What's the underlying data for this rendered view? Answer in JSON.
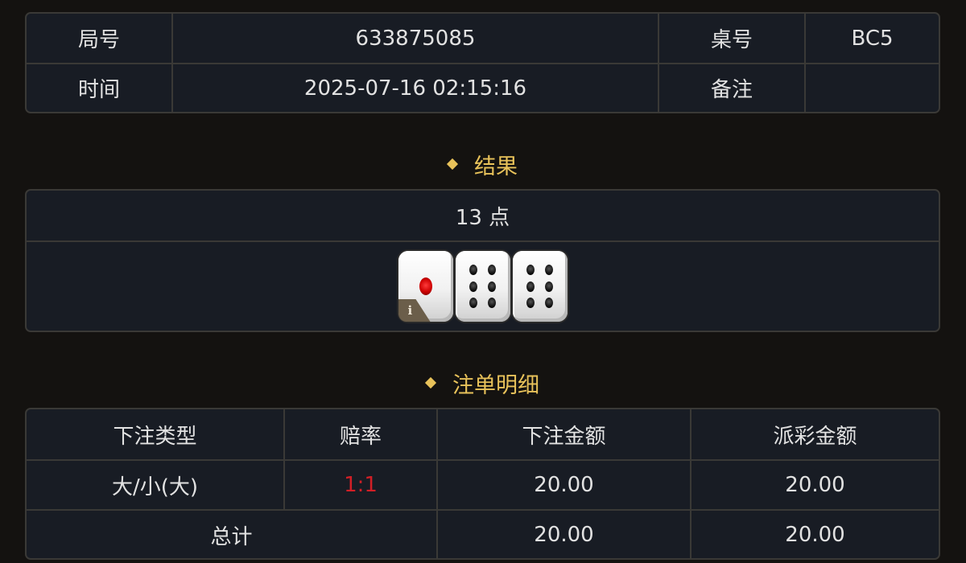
{
  "info": {
    "round_label": "局号",
    "round_value": "633875085",
    "table_label": "桌号",
    "table_value": "BC5",
    "time_label": "时间",
    "time_value": "2025-07-16 02:15:16",
    "remark_label": "备注",
    "remark_value": ""
  },
  "result": {
    "title": "结果",
    "points_text": "13 点",
    "dice": [
      1,
      6,
      6
    ],
    "info_badge": "i"
  },
  "bets": {
    "title": "注单明细",
    "headers": [
      "下注类型",
      "赔率",
      "下注金额",
      "派彩金额"
    ],
    "rows": [
      {
        "type": "大/小(大)",
        "odds": "1:1",
        "stake": "20.00",
        "payout": "20.00"
      }
    ],
    "total": {
      "label": "总计",
      "stake": "20.00",
      "payout": "20.00"
    }
  },
  "colors": {
    "accent": "#e8c25a",
    "odds": "#d21f26",
    "panel_bg": "#181c24",
    "page_bg": "#141210"
  }
}
